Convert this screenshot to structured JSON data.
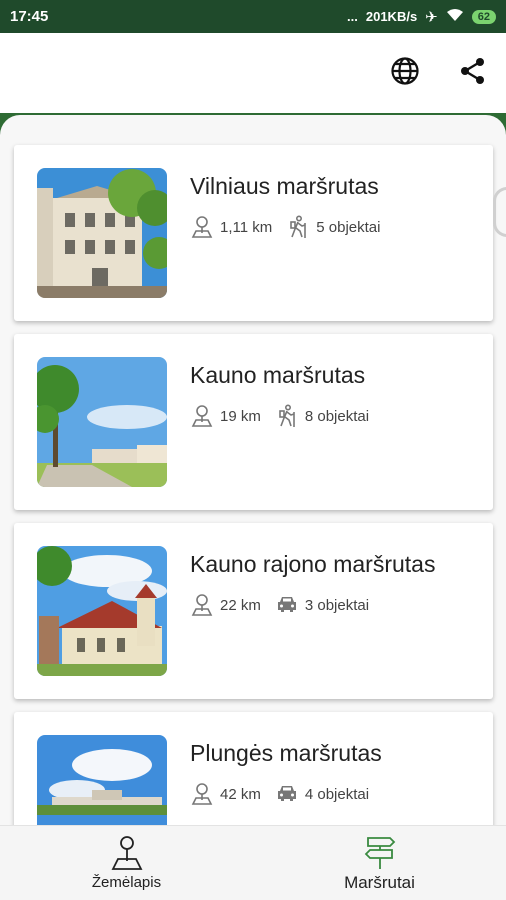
{
  "status_bar": {
    "time": "17:45",
    "dots": "...",
    "speed": "201KB/s",
    "battery": "62"
  },
  "app_bar": {
    "language_icon": "globe-icon",
    "share_icon": "share-icon"
  },
  "routes": [
    {
      "title": "Vilniaus maršrutas",
      "distance": "1,11 km",
      "objects": "5 objektai",
      "mode_icon": "hiking-icon"
    },
    {
      "title": "Kauno maršrutas",
      "distance": "19 km",
      "objects": "8 objektai",
      "mode_icon": "hiking-icon"
    },
    {
      "title": "Kauno rajono maršrutas",
      "distance": "22 km",
      "objects": "3 objektai",
      "mode_icon": "car-icon"
    },
    {
      "title": "Plungės maršrutas",
      "distance": "42 km",
      "objects": "4 objektai",
      "mode_icon": "car-icon"
    }
  ],
  "bottom_nav": {
    "items": [
      {
        "label": "Žemėlapis",
        "icon": "map-pin-icon",
        "active": false
      },
      {
        "label": "Maršrutai",
        "icon": "signpost-icon",
        "active": true
      }
    ]
  },
  "colors": {
    "brand_dark": "#1f4a2b",
    "brand_green": "#2e6b34",
    "active_icon": "#3a8a40"
  }
}
